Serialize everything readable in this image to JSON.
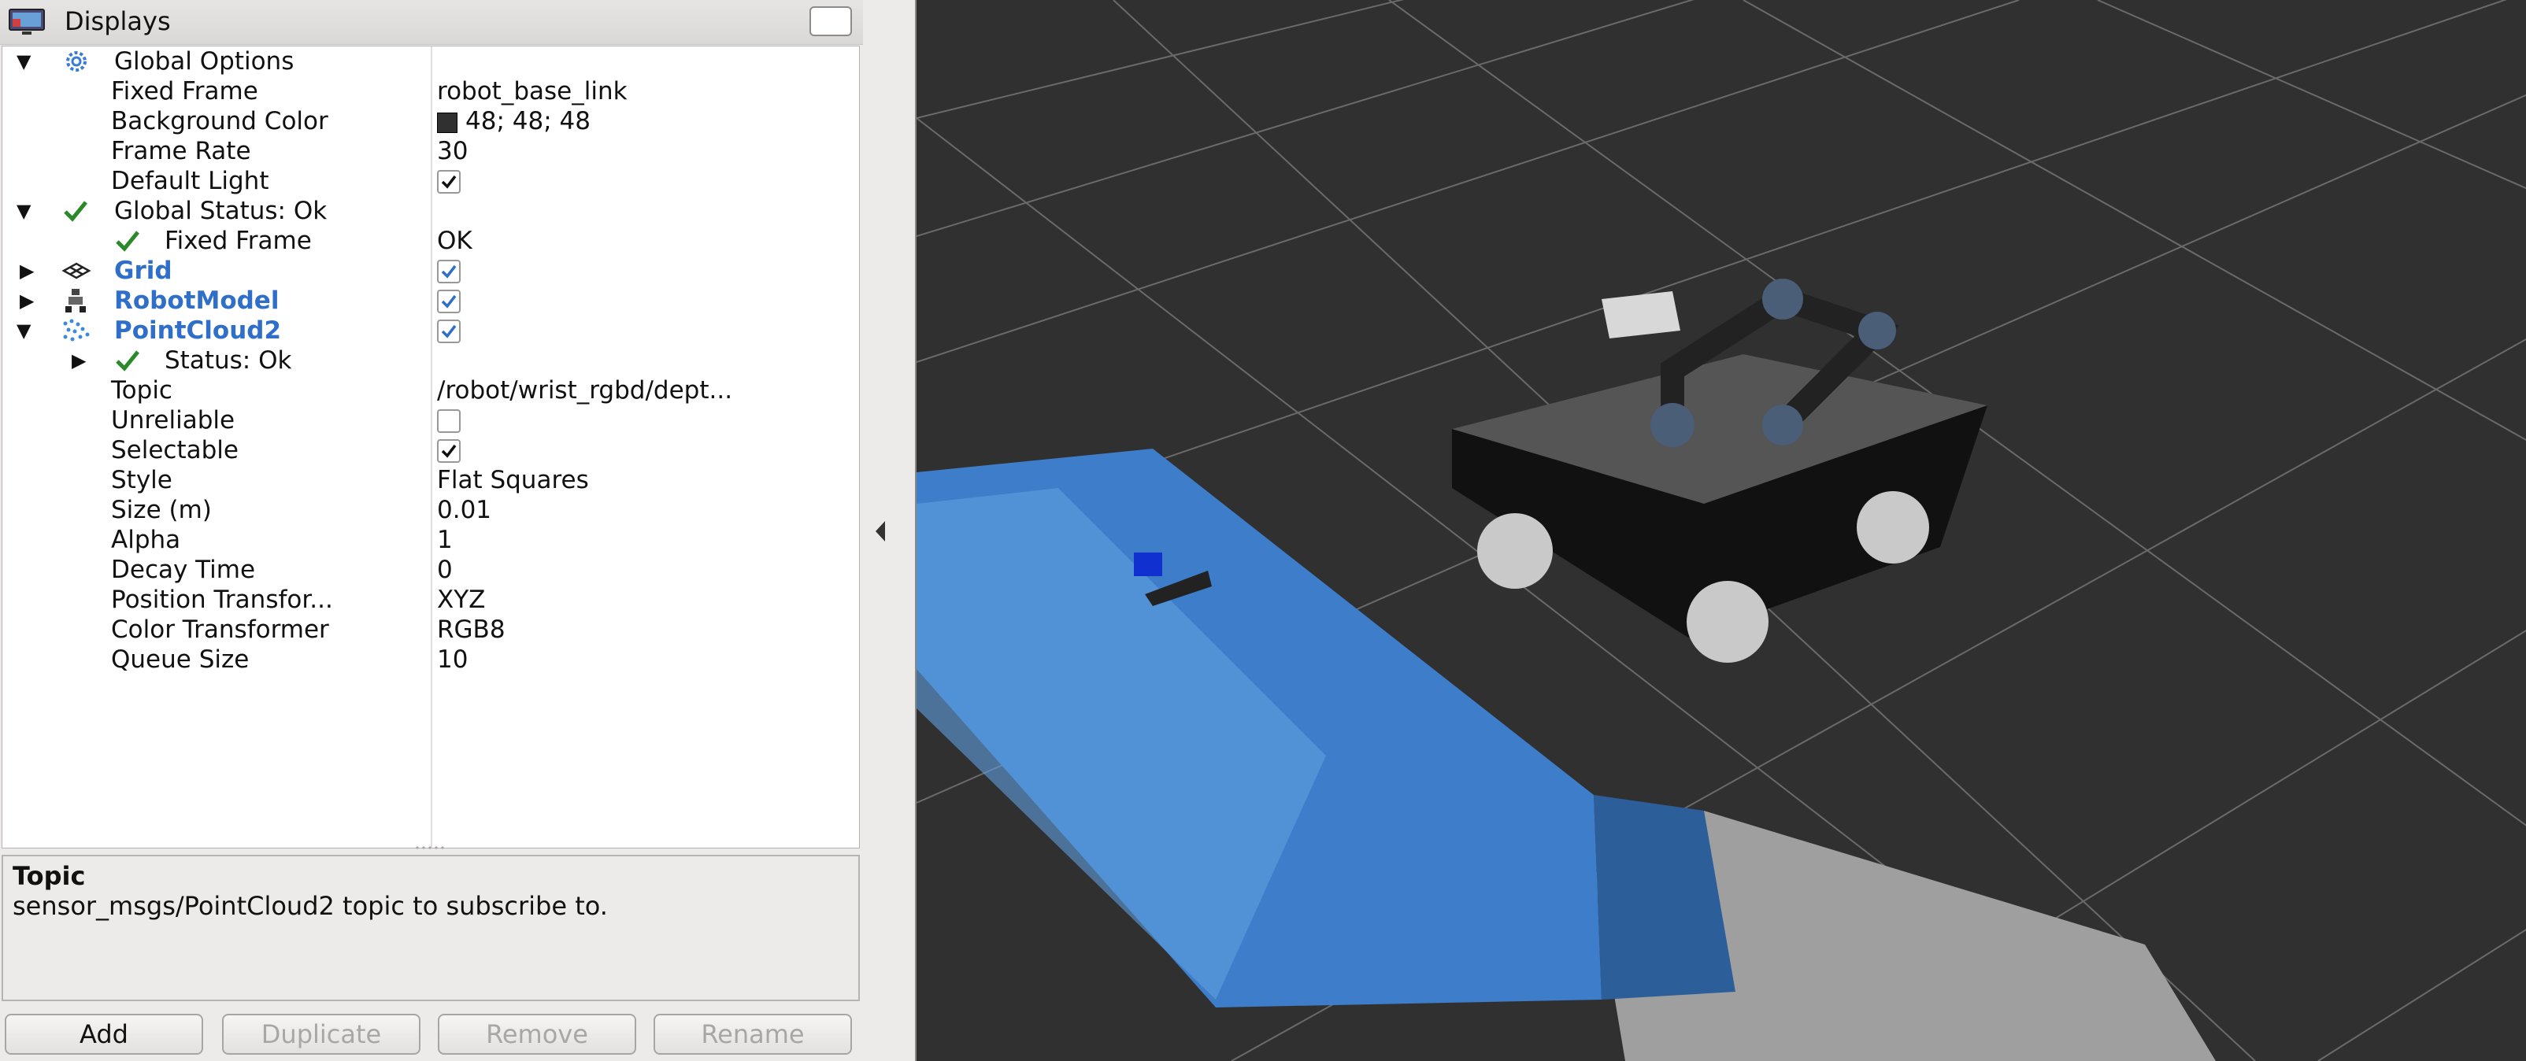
{
  "panel": {
    "title": "Displays"
  },
  "tree": {
    "global_options": {
      "label": "Global Options",
      "fixed_frame": {
        "key": "Fixed Frame",
        "value": "robot_base_link"
      },
      "background_color": {
        "key": "Background Color",
        "value": "48; 48; 48",
        "swatch": "#303030"
      },
      "frame_rate": {
        "key": "Frame Rate",
        "value": "30"
      },
      "default_light": {
        "key": "Default Light",
        "checked": true
      }
    },
    "global_status": {
      "label": "Global Status: Ok",
      "fixed_frame": {
        "key": "Fixed Frame",
        "value": "OK"
      }
    },
    "grid": {
      "label": "Grid",
      "checked": true
    },
    "robot_model": {
      "label": "RobotModel",
      "checked": true
    },
    "pointcloud": {
      "label": "PointCloud2",
      "checked": true,
      "status": "Status: Ok",
      "topic": {
        "key": "Topic",
        "value": "/robot/wrist_rgbd/dept..."
      },
      "unreliable": {
        "key": "Unreliable",
        "checked": false
      },
      "selectable": {
        "key": "Selectable",
        "checked": true
      },
      "style": {
        "key": "Style",
        "value": "Flat Squares"
      },
      "size": {
        "key": "Size (m)",
        "value": "0.01"
      },
      "alpha": {
        "key": "Alpha",
        "value": "1"
      },
      "decay_time": {
        "key": "Decay Time",
        "value": "0"
      },
      "position_transformer": {
        "key": "Position Transfor...",
        "value": "XYZ"
      },
      "color_transformer": {
        "key": "Color Transformer",
        "value": "RGB8"
      },
      "queue_size": {
        "key": "Queue Size",
        "value": "10"
      }
    }
  },
  "description": {
    "title": "Topic",
    "text": "sensor_msgs/PointCloud2 topic to subscribe to."
  },
  "buttons": {
    "add": "Add",
    "duplicate": "Duplicate",
    "remove": "Remove",
    "rename": "Rename"
  },
  "colors": {
    "accent_blue": "#2f6fc9",
    "ok_green": "#2a8a2a",
    "viewport_bg": "#303030"
  }
}
